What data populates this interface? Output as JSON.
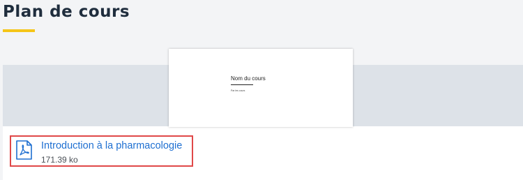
{
  "page": {
    "title": "Plan de cours"
  },
  "thumbnail": {
    "doc_title": "Nom du cours",
    "doc_subtitle": "Par les cours"
  },
  "file": {
    "name": "Introduction à la pharmacologie",
    "size": "171.39 ko",
    "icon": "pdf-icon"
  },
  "colors": {
    "accent": "#f5c518",
    "link": "#1e6fd1",
    "highlight_border": "#e04848",
    "title": "#1f2d3d"
  }
}
